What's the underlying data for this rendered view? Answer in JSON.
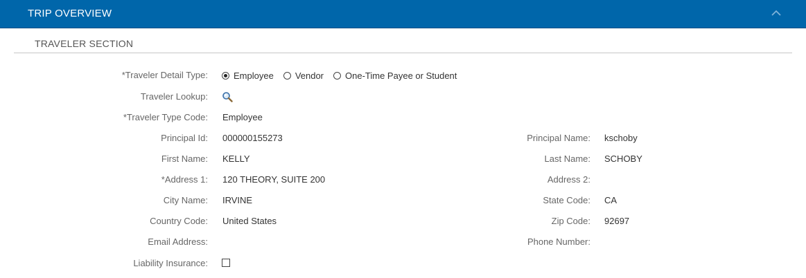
{
  "header": {
    "title": "TRIP OVERVIEW",
    "collapse_icon": "chevron-up-icon"
  },
  "section": {
    "title": "TRAVELER SECTION"
  },
  "fields": {
    "detail_type": {
      "label": "*Traveler Detail Type:",
      "options": [
        {
          "label": "Employee",
          "selected": true
        },
        {
          "label": "Vendor",
          "selected": false
        },
        {
          "label": "One-Time Payee or Student",
          "selected": false
        }
      ]
    },
    "lookup": {
      "label": "Traveler Lookup:",
      "icon": "search-icon"
    },
    "type_code": {
      "label": "*Traveler Type Code:",
      "value": "Employee"
    },
    "principal_id": {
      "label": "Principal Id:",
      "value": "000000155273"
    },
    "principal_name": {
      "label": "Principal Name:",
      "value": "kschoby"
    },
    "first_name": {
      "label": "First Name:",
      "value": "KELLY"
    },
    "last_name": {
      "label": "Last Name:",
      "value": "SCHOBY"
    },
    "address1": {
      "label": "*Address 1:",
      "value": "120 THEORY, SUITE 200"
    },
    "address2": {
      "label": "Address 2:",
      "value": ""
    },
    "city": {
      "label": "City Name:",
      "value": "IRVINE"
    },
    "state": {
      "label": "State Code:",
      "value": "CA"
    },
    "country": {
      "label": "Country Code:",
      "value": "United States"
    },
    "zip": {
      "label": "Zip Code:",
      "value": "92697"
    },
    "email": {
      "label": "Email Address:",
      "value": ""
    },
    "phone": {
      "label": "Phone Number:",
      "value": ""
    },
    "liability": {
      "label": "Liability Insurance:",
      "checked": false
    }
  },
  "colors": {
    "header_bg": "#0066aa",
    "label": "#666666",
    "value": "#333333",
    "rule": "#c6c6c6"
  }
}
